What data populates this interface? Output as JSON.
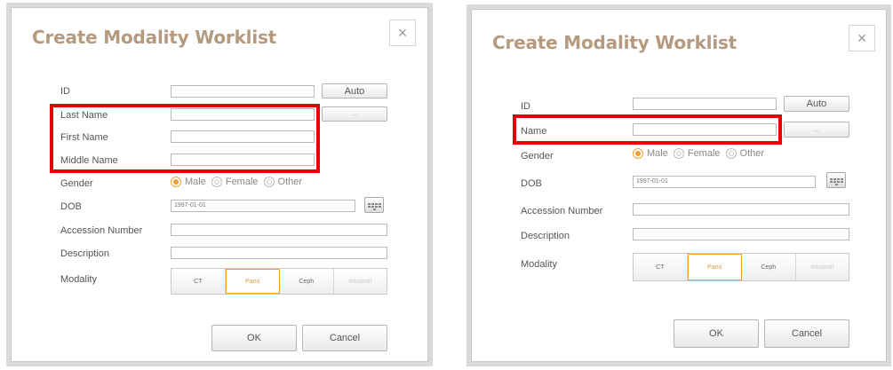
{
  "left": {
    "title": "Create Modality Worklist",
    "close_symbol": "×",
    "labels": {
      "id": "ID",
      "last_name": "Last Name",
      "first_name": "First Name",
      "middle_name": "Middle Name",
      "gender": "Gender",
      "dob": "DOB",
      "accession": "Accession Number",
      "description": "Description",
      "modality": "Modality"
    },
    "auto_button": "Auto",
    "more_button": "...",
    "gender_options": [
      "Male",
      "Female",
      "Other"
    ],
    "dob_value": "1997-01-01",
    "modality_options": [
      "CT",
      "Pano",
      "Ceph",
      "Intraoral"
    ],
    "ok_button": "OK",
    "cancel_button": "Cancel"
  },
  "right": {
    "title": "Create Modality Worklist",
    "close_symbol": "×",
    "labels": {
      "id": "ID",
      "name": "Name",
      "gender": "Gender",
      "dob": "DOB",
      "accession": "Accession Number",
      "description": "Description",
      "modality": "Modality"
    },
    "auto_button": "Auto",
    "more_button": "...",
    "gender_options": [
      "Male",
      "Female",
      "Other"
    ],
    "dob_value": "1997-01-01",
    "modality_options": [
      "CT",
      "Pano",
      "Ceph",
      "Intraoral"
    ],
    "ok_button": "OK",
    "cancel_button": "Cancel"
  },
  "selected": {
    "gender": "Male",
    "modality": "Pano"
  },
  "colors": {
    "title": "#b59a7f",
    "accent": "#f0a030",
    "highlight": "#e60000"
  }
}
